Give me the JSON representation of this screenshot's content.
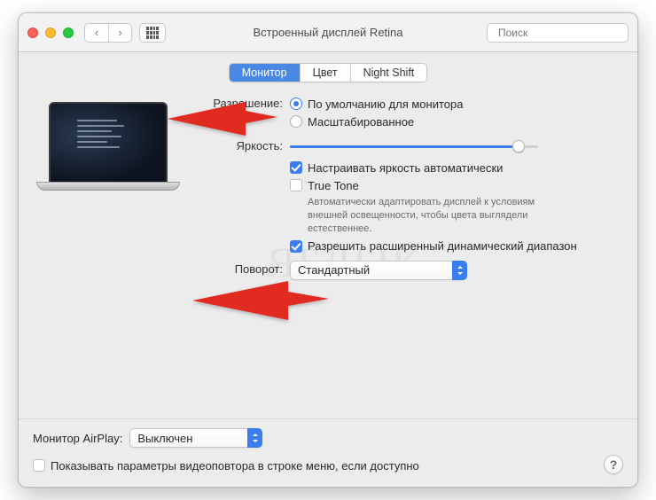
{
  "window": {
    "title": "Встроенный дисплей Retina"
  },
  "toolbar": {
    "search_placeholder": "Поиск"
  },
  "tabs": [
    {
      "label": "Монитор",
      "active": true
    },
    {
      "label": "Цвет",
      "active": false
    },
    {
      "label": "Night Shift",
      "active": false
    }
  ],
  "settings": {
    "resolution": {
      "label": "Разрешение:",
      "options": [
        {
          "label": "По умолчанию для монитора",
          "checked": true
        },
        {
          "label": "Масштабированное",
          "checked": false
        }
      ]
    },
    "brightness": {
      "label": "Яркость:",
      "value_pct": 92,
      "auto": {
        "label": "Настраивать яркость автоматически",
        "checked": true
      }
    },
    "truetone": {
      "label": "True Tone",
      "checked": false,
      "description": "Автоматически адаптировать дисплей к условиям внешней освещенности, чтобы цвета выглядели естественнее."
    },
    "hdr": {
      "label": "Разрешить расширенный динамический диапазон",
      "checked": true
    },
    "rotation": {
      "label": "Поворот:",
      "value": "Стандартный"
    }
  },
  "footer": {
    "airplay": {
      "label": "Монитор AirPlay:",
      "value": "Выключен"
    },
    "mirroring": {
      "label": "Показывать параметры видеоповтора в строке меню, если доступно",
      "checked": false
    }
  },
  "help": "?",
  "watermark": "ЯБЛЫК"
}
